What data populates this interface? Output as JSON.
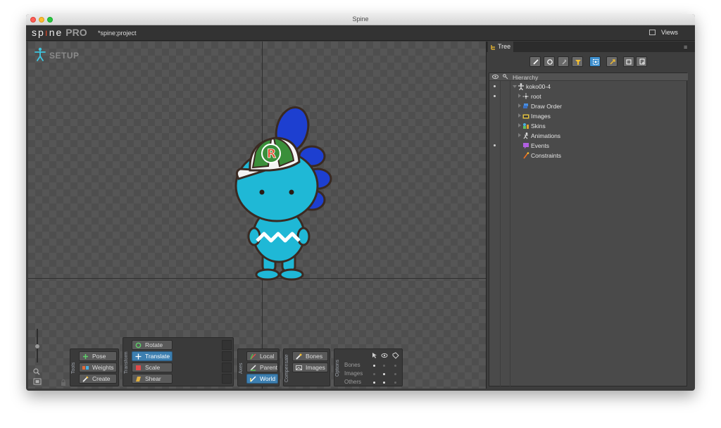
{
  "window": {
    "title": "Spine"
  },
  "app": {
    "logo": "sp ne",
    "logo_edition": "PRO",
    "project_name": "*spine;project",
    "views_label": "Views"
  },
  "viewport": {
    "mode_label": "SETUP"
  },
  "tools": {
    "group_label": "Tools",
    "pose": "Pose",
    "weights": "Weights",
    "create": "Create"
  },
  "transform": {
    "group_label": "Transform",
    "rotate": "Rotate",
    "translate": "Translate",
    "scale": "Scale",
    "shear": "Shear",
    "active": "translate"
  },
  "axes": {
    "group_label": "Axes",
    "local": "Local",
    "parent": "Parent",
    "world": "World",
    "active": "world"
  },
  "compensate": {
    "group_label": "Compensate",
    "bones": "Bones",
    "images": "Images"
  },
  "options": {
    "group_label": "Options",
    "rows": [
      "Bones",
      "Images",
      "Others"
    ]
  },
  "tree": {
    "tab_label": "Tree",
    "header_label": "Hierarchy",
    "items": [
      {
        "label": "koko00-4",
        "icon": "skeleton-icon"
      },
      {
        "label": "root",
        "icon": "bone-icon"
      },
      {
        "label": "Draw Order",
        "icon": "draw-order-icon"
      },
      {
        "label": "Images",
        "icon": "folder-icon"
      },
      {
        "label": "Skins",
        "icon": "skins-icon"
      },
      {
        "label": "Animations",
        "icon": "animation-icon"
      },
      {
        "label": "Events",
        "icon": "events-icon"
      },
      {
        "label": "Constraints",
        "icon": "constraints-icon"
      }
    ]
  },
  "colors": {
    "accent": "#3d8ecd",
    "active_button": "#3d7fb0",
    "character_body": "#1fb8d6",
    "character_tail": "#1d3fd0",
    "cap_green": "#3a8f3a"
  }
}
